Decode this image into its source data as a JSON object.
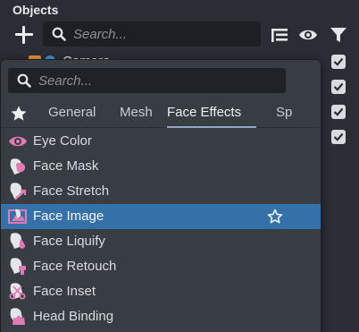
{
  "panel": {
    "title": "Objects"
  },
  "toolbar": {
    "search_placeholder": "Search...",
    "icons": [
      "add-icon",
      "search-icon",
      "list-icon",
      "eye-icon",
      "filter-icon"
    ]
  },
  "objects": [
    {
      "label": "Camera",
      "checked": true
    },
    {
      "label": "",
      "checked": true
    },
    {
      "label": "",
      "checked": true
    },
    {
      "label": "",
      "checked": true
    }
  ],
  "popup": {
    "search_placeholder": "Search...",
    "tabs": [
      "General",
      "Mesh",
      "Face Effects",
      "Sp"
    ],
    "active_tab": "Face Effects",
    "items": [
      {
        "label": "Eye Color",
        "icon": "eye-color-icon"
      },
      {
        "label": "Face Mask",
        "icon": "face-mask-icon"
      },
      {
        "label": "Face Stretch",
        "icon": "face-stretch-icon"
      },
      {
        "label": "Face Image",
        "icon": "face-image-icon",
        "selected": true
      },
      {
        "label": "Face Liquify",
        "icon": "face-liquify-icon"
      },
      {
        "label": "Face Retouch",
        "icon": "face-retouch-icon"
      },
      {
        "label": "Face Inset",
        "icon": "face-inset-icon"
      },
      {
        "label": "Head Binding",
        "icon": "head-binding-icon"
      }
    ]
  },
  "colors": {
    "accent_pink": "#e07bb5",
    "selection": "#3571a9",
    "panel_bg": "#2a2d33",
    "popup_bg": "#383c43"
  }
}
